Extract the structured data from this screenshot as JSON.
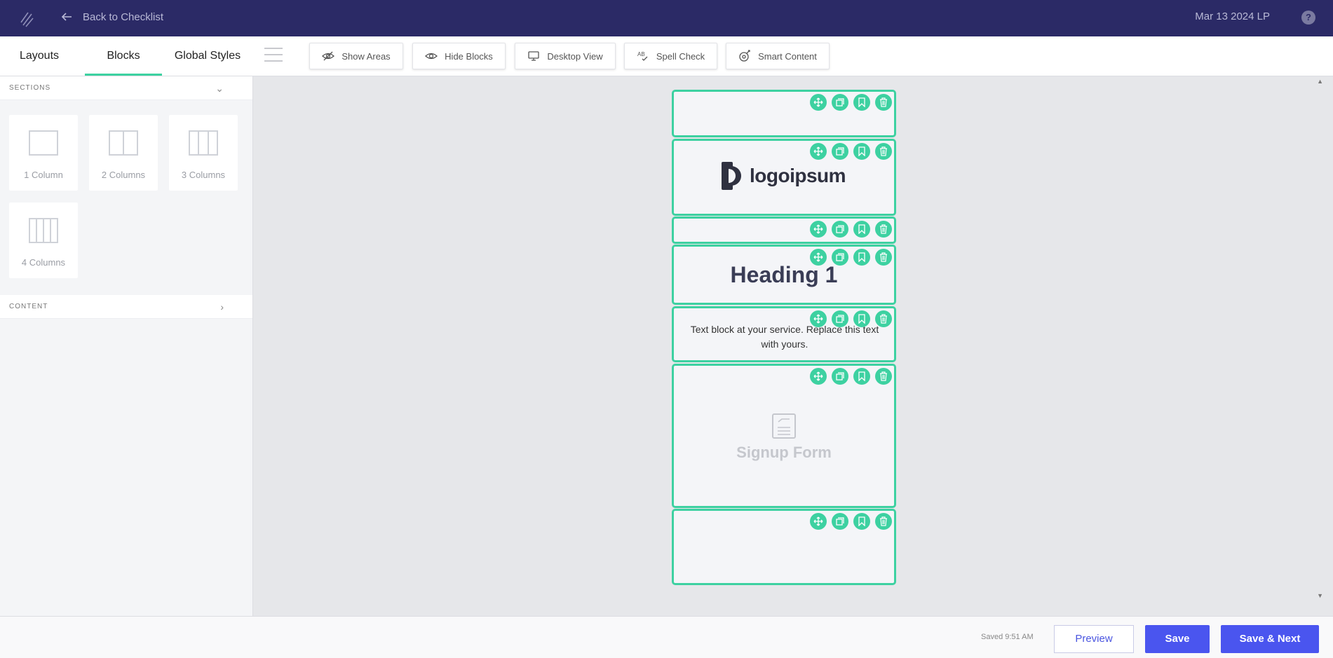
{
  "header": {
    "back_label": "Back to Checklist",
    "project_name": "Mar 13 2024 LP",
    "help_glyph": "?"
  },
  "tabs": [
    {
      "label": "Layouts"
    },
    {
      "label": "Blocks",
      "active": true
    },
    {
      "label": "Global Styles"
    }
  ],
  "tools": {
    "show_areas": "Show Areas",
    "hide_blocks": "Hide Blocks",
    "desktop_view": "Desktop View",
    "spell_check": "Spell Check",
    "smart_content": "Smart Content"
  },
  "sidebar": {
    "sections_label": "SECTIONS",
    "content_label": "CONTENT",
    "layouts": [
      {
        "label": "1 Column",
        "columns": 1
      },
      {
        "label": "2 Columns",
        "columns": 2
      },
      {
        "label": "3 Columns",
        "columns": 3
      },
      {
        "label": "4 Columns",
        "columns": 4
      }
    ]
  },
  "canvas": {
    "logo_text": "logoipsum",
    "heading_text": "Heading 1",
    "text_block": "Text block at your service. Replace this text with yours.",
    "signup_label": "Signup Form"
  },
  "footer": {
    "saved_status": "Saved 9:51 AM",
    "preview_label": "Preview",
    "save_label": "Save",
    "save_next_label": "Save & Next"
  },
  "colors": {
    "header_bg": "#2b2a66",
    "accent_green": "#3dd1a1",
    "primary_blue": "#4a55ef"
  }
}
